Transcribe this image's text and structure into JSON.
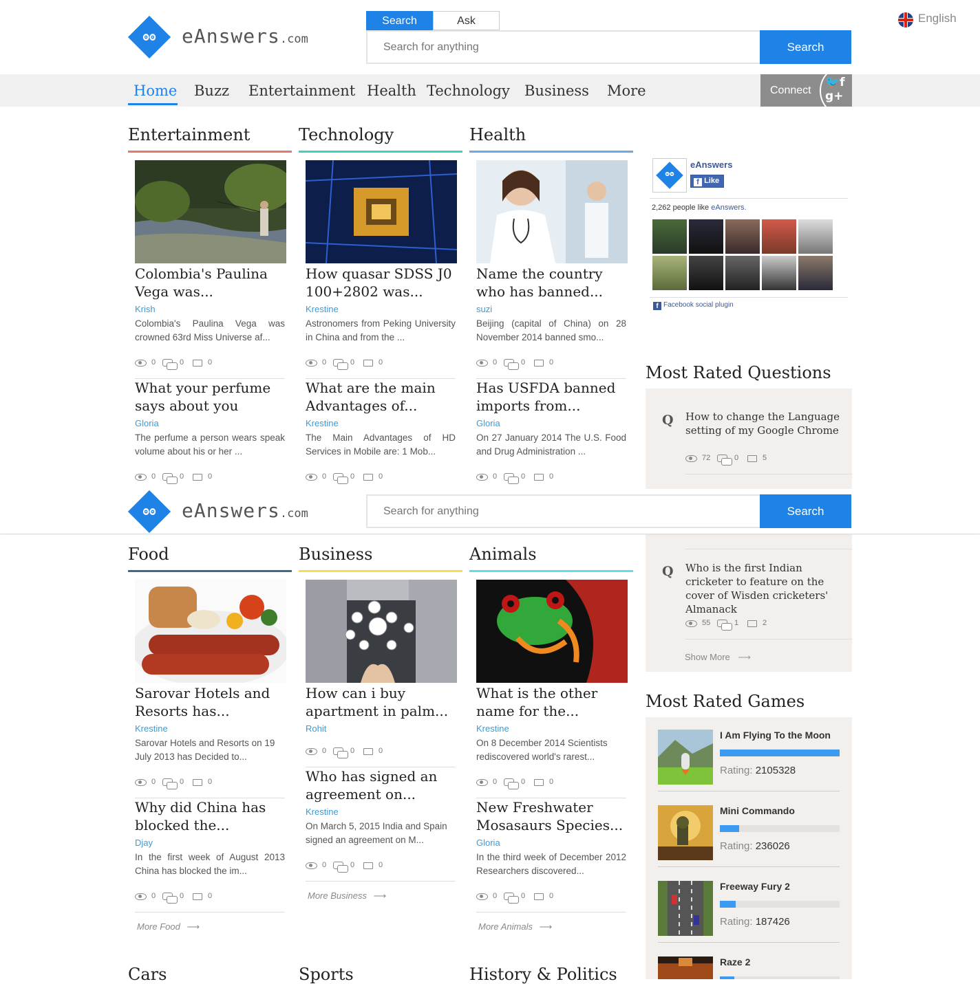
{
  "header": {
    "logo_name": "eAnswers",
    "logo_tld": ".com",
    "tabs": [
      "Search",
      "Ask"
    ],
    "search_placeholder": "Search for anything",
    "search_button": "Search",
    "language": "English"
  },
  "nav": {
    "items": [
      "Home",
      "Buzz",
      "Entertainment",
      "Health",
      "Technology",
      "Business",
      "More"
    ],
    "connect": "Connect"
  },
  "sections": [
    {
      "title": "Entertainment",
      "color": "#e8776b",
      "articles": [
        {
          "title": "Colombia's Paulina Vega was...",
          "author": "Krish",
          "body": "Colombia's Paulina Vega was crowned 63rd Miss Universe af...",
          "views": "0",
          "answers": "0",
          "comments": "0"
        },
        {
          "title": "What your perfume says about you",
          "author": "Gloria",
          "body": "The perfume a person wears speak volume about his or her ...",
          "views": "0",
          "answers": "0",
          "comments": "0"
        }
      ]
    },
    {
      "title": "Technology",
      "color": "#3fd0c4",
      "articles": [
        {
          "title": "How quasar SDSS J0 100+2802 was...",
          "author": "Krestine",
          "body": "Astronomers from Peking University in China and from the ...",
          "views": "0",
          "answers": "0",
          "comments": "0"
        },
        {
          "title": "What are the main Advantages of...",
          "author": "Krestine",
          "body": "The Main Advantages of HD Services in Mobile are: 1 Mob...",
          "views": "0",
          "answers": "0",
          "comments": "0"
        }
      ]
    },
    {
      "title": "Health",
      "color": "#6aa8e8",
      "articles": [
        {
          "title": "Name the country who has banned...",
          "author": "suzi",
          "body": "Beijing (capital of China) on 28 November 2014 banned smo...",
          "views": "0",
          "answers": "0",
          "comments": "0"
        },
        {
          "title": "Has USFDA banned imports from...",
          "author": "Gloria",
          "body": "On 27 January 2014 The U.S. Food and Drug Administration ...",
          "views": "0",
          "answers": "0",
          "comments": "0"
        }
      ]
    },
    {
      "title": "Food",
      "color": "#3d6b86",
      "more": "More Food",
      "articles": [
        {
          "title": "Sarovar Hotels and Resorts has...",
          "author": "Krestine",
          "body": "Sarovar Hotels and Resorts on 19 July 2013 has Decided to...",
          "views": "0",
          "answers": "0",
          "comments": "0"
        },
        {
          "title": "Why did China has blocked the...",
          "author": "Djay",
          "body": "In the first week of August 2013 China has blocked the im...",
          "views": "0",
          "answers": "0",
          "comments": "0"
        }
      ]
    },
    {
      "title": "Business",
      "color": "#f4e04a",
      "more": "More Business",
      "articles": [
        {
          "title": "How can i buy apartment in palm...",
          "author": "Rohit",
          "body": "",
          "views": "0",
          "answers": "0",
          "comments": "0"
        },
        {
          "title": "Who has signed an agreement on...",
          "author": "Krestine",
          "body": "On March 5, 2015 India and Spain signed an agreement on M...",
          "views": "0",
          "answers": "0",
          "comments": "0"
        }
      ]
    },
    {
      "title": "Animals",
      "color": "#5ce0ea",
      "more": "More Animals",
      "articles": [
        {
          "title": "What is the other name for the...",
          "author": "Krestine",
          "body": "On 8 December 2014 Scientists rediscovered world's rarest...",
          "views": "0",
          "answers": "0",
          "comments": "0"
        },
        {
          "title": "New Freshwater Mosasaurs Species...",
          "author": "Gloria",
          "body": "In the third week of December 2012 Researchers discovered...",
          "views": "0",
          "answers": "0",
          "comments": "0"
        }
      ]
    },
    {
      "title": "Cars"
    },
    {
      "title": "Sports"
    },
    {
      "title": "History & Politics"
    }
  ],
  "facebook": {
    "page_name": "eAnswers",
    "like_button": "Like",
    "count_text": "2,262 people like",
    "count_page": "eAnswers.",
    "plugin": "Facebook social plugin"
  },
  "questions": {
    "title": "Most Rated Questions",
    "items": [
      {
        "mark": "Q",
        "text": "How to change the Language setting of my Google Chrome",
        "views": "72",
        "answers": "0",
        "comments": "5"
      },
      {
        "mark": "Q",
        "text": "Who is the first Indian cricketer to feature on the cover of Wisden cricketers' Almanack",
        "views": "55",
        "answers": "1",
        "comments": "2"
      }
    ],
    "show_more": "Show More"
  },
  "games": {
    "title": "Most Rated Games",
    "rating_label": "Rating:",
    "items": [
      {
        "name": "I Am Flying To the Moon",
        "rating": "2105328",
        "fill": 1.0
      },
      {
        "name": "Mini Commando",
        "rating": "236026",
        "fill": 0.16
      },
      {
        "name": "Freeway Fury 2",
        "rating": "187426",
        "fill": 0.13
      },
      {
        "name": "Raze 2",
        "rating": "",
        "fill": 0.12
      }
    ]
  },
  "colors": {
    "accent": "#1e82e6",
    "link": "#3a9bd8",
    "panel": "#f2efec"
  }
}
